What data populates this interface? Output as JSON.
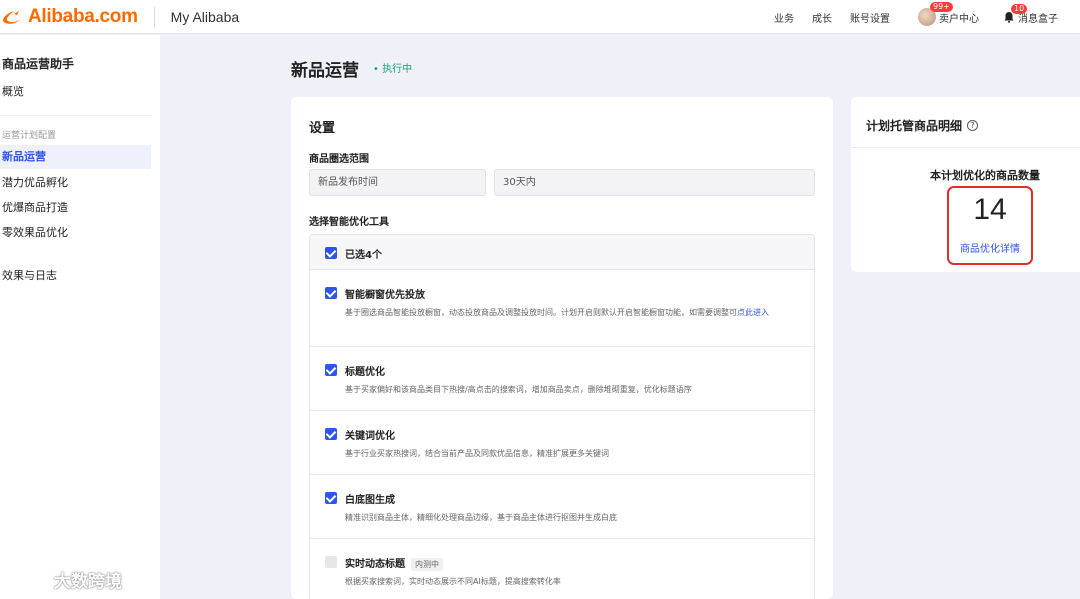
{
  "brand": {
    "name": "Alibaba.com",
    "section": "My Alibaba",
    "accent": "#ff6a00"
  },
  "nav": {
    "links": [
      "业务",
      "成长",
      "账号设置"
    ],
    "seller_center": "卖户中心",
    "seller_badge": "99+",
    "messages": "消息盒子",
    "messages_badge": "10"
  },
  "sidebar": {
    "title": "商品运营助手",
    "overview": "概览",
    "group_label": "运营计划配置",
    "items": [
      "新品运营",
      "潜力优品孵化",
      "优爆商品打造",
      "零效果品优化"
    ],
    "active_index": 0,
    "logs": "效果与日志"
  },
  "page": {
    "title": "新品运营",
    "status": "• 执行中",
    "status_color": "#1aa36f"
  },
  "settings": {
    "title": "设置",
    "scope_label": "商品圈选范围",
    "scope_field": "新品发布时间",
    "scope_value": "30天内",
    "tools_label": "选择智能优化工具",
    "selected_text": "已选4个",
    "tools": [
      {
        "name": "智能橱窗优先投放",
        "desc": "基于圈选商品智能投放橱窗，动态投放商品及调整投放时间。计划开启则默认开启智能橱窗功能，如需要调整可",
        "link": "点此进入",
        "checked": true
      },
      {
        "name": "标题优化",
        "desc": "基于买家偏好和该商品类目下热搜/高点击的搜索词，增加商品卖点，删除堆砌重复，优化标题语序",
        "checked": true
      },
      {
        "name": "关键词优化",
        "desc": "基于行业买家热搜词，结合当前产品及同款优品信息，精准扩展更多关键词",
        "checked": true
      },
      {
        "name": "白底图生成",
        "desc": "精准识别商品主体，精细化处理商品边缘，基于商品主体进行抠图并生成白底",
        "checked": true
      },
      {
        "name": "实时动态标题",
        "tag": "内测中",
        "desc": "根据买家搜索词，实时动态展示不同AI标题，提高搜索转化率",
        "checked": false
      }
    ]
  },
  "detail": {
    "title": "计划托管商品明细",
    "help_icon": "?",
    "subtitle": "本计划优化的商品数量",
    "count": "14",
    "link": "商品优化详情"
  },
  "watermark": {
    "text": "大数跨境"
  }
}
